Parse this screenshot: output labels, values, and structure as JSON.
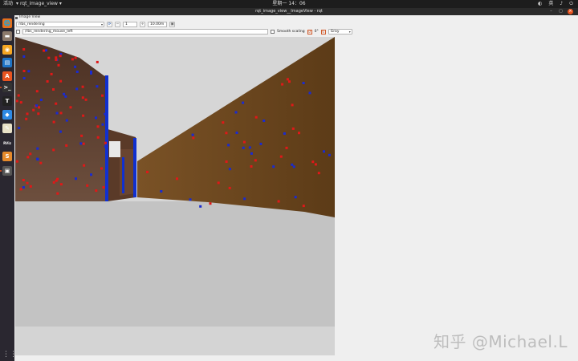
{
  "topbar": {
    "activities": "活动",
    "app_menu": "rqt_image_view",
    "clock": "星期一 14：06",
    "lang": "英",
    "tray_power": "⏻"
  },
  "window": {
    "title": "rqt_image_view__ImageView - rqt"
  },
  "plugin": {
    "title": "Image View",
    "topic_combo": "/rbs_rendering",
    "zoom_value": "1",
    "max_range": "10.00m",
    "mouse_topic": "/rbs_rendering_mouse_left",
    "smooth_label": "Smooth scaling",
    "rotate_value": "0°",
    "color_combo": "Gray"
  },
  "colors": {
    "accent": "#e95420",
    "launcher_bg": "#2a2730",
    "topbar_bg": "#1d1d1d"
  },
  "dock": [
    {
      "name": "firefox-icon",
      "glyph": "🌐",
      "bg": "#e76f1a"
    },
    {
      "name": "files-icon",
      "glyph": "▬",
      "bg": "#8c7a6b"
    },
    {
      "name": "rhythmbox-icon",
      "glyph": "◉",
      "bg": "#f5a623"
    },
    {
      "name": "libreoffice-writer-icon",
      "glyph": "▤",
      "bg": "#1f74c6"
    },
    {
      "name": "software-center-icon",
      "glyph": "A",
      "bg": "#e95420"
    },
    {
      "name": "terminal-icon",
      "glyph": ">_",
      "bg": "#333"
    },
    {
      "name": "typora-icon",
      "glyph": "T",
      "bg": "#222"
    },
    {
      "name": "vscode-icon",
      "glyph": "◆",
      "bg": "#2e8ae6"
    },
    {
      "name": "text-editor-icon",
      "glyph": "✎",
      "bg": "#e8e2c8"
    },
    {
      "name": "rviz-icon",
      "glyph": "RViz",
      "bg": "#2a2730"
    },
    {
      "name": "sublime-icon",
      "glyph": "S",
      "bg": "#e58a2b"
    },
    {
      "name": "window-icon",
      "glyph": "▣",
      "bg": "#555"
    }
  ],
  "watermark": "知乎 @Michael.L"
}
